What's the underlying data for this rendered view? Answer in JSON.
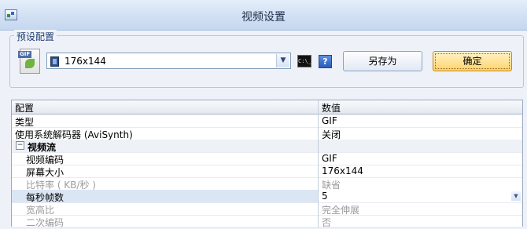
{
  "window": {
    "title": "视频设置"
  },
  "preset": {
    "group_label": "预设配置",
    "selected": "176x144",
    "save_as_label": "另存为",
    "ok_label": "确定",
    "cmd_icon_text": "C:\\_",
    "help_icon_text": "?"
  },
  "grid": {
    "headers": {
      "key": "配置",
      "value": "数值"
    },
    "rows": [
      {
        "key": "类型",
        "value": "GIF"
      },
      {
        "key": "使用系统解码器 (AviSynth)",
        "value": "关闭"
      }
    ],
    "category": {
      "label": "视频流",
      "expander": "−"
    },
    "sub_rows": [
      {
        "key": "视频编码",
        "value": "GIF"
      },
      {
        "key": "屏幕大小",
        "value": "176x144"
      },
      {
        "key": "比特率 ( KB/秒 )",
        "value": "缺省"
      },
      {
        "key": "每秒帧数",
        "value": "5"
      },
      {
        "key": "宽高比",
        "value": "完全伸展"
      },
      {
        "key": "二次编码",
        "value": "否"
      }
    ]
  },
  "colors": {
    "selected_row": "#dbe6f5",
    "ok_button": "#ffd36b",
    "disabled_text": "#9c9c9c"
  }
}
